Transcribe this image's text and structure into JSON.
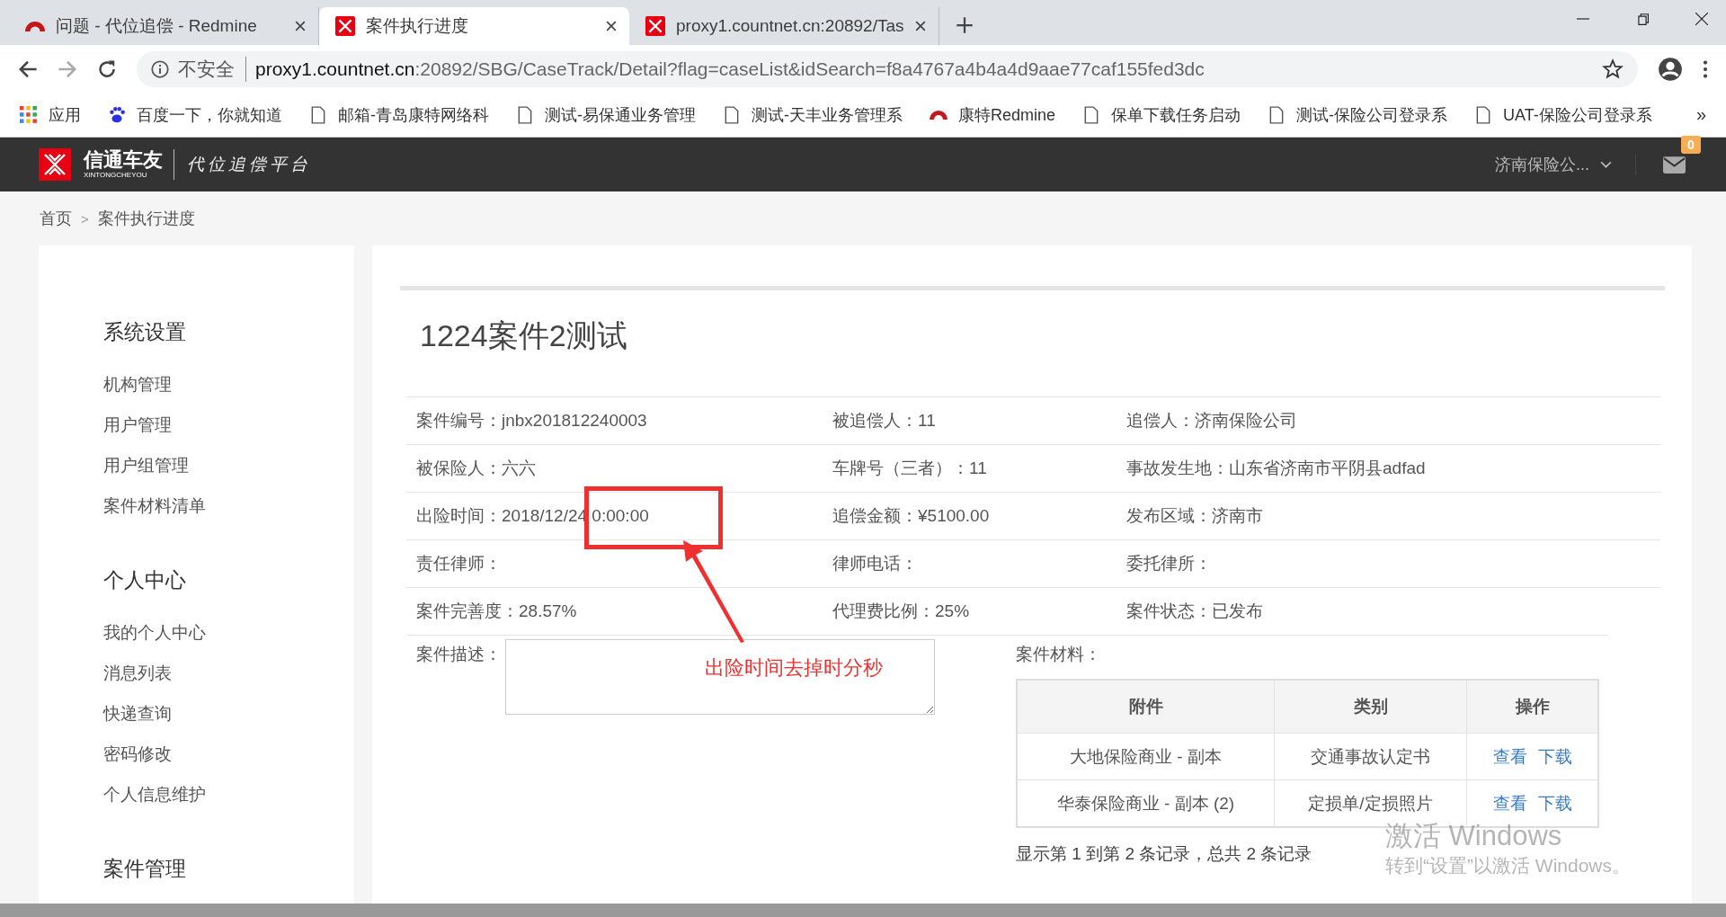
{
  "browser": {
    "tabs": [
      {
        "title": "问题 - 代位追偿 - Redmine",
        "kind": "redmine",
        "selected": false
      },
      {
        "title": "案件执行进度",
        "kind": "logo",
        "selected": true
      },
      {
        "title": "proxy1.countnet.cn:20892/Tas",
        "kind": "logo",
        "selected": false
      }
    ],
    "security": "不安全",
    "url_host": "proxy1.countnet.cn",
    "url_rest": ":20892/SBG/CaseTrack/Detail?flag=caseList&idSearch=f8a4767a4b4a4d9aae77caf155fed3dc",
    "bookmarks": [
      {
        "label": "应用",
        "kind": "apps"
      },
      {
        "label": "百度一下，你就知道",
        "kind": "paw"
      },
      {
        "label": "邮箱-青岛康特网络科",
        "kind": "page"
      },
      {
        "label": "测试-易保通业务管理",
        "kind": "page"
      },
      {
        "label": "测试-天丰业务管理系",
        "kind": "page"
      },
      {
        "label": "康特Redmine",
        "kind": "redmine"
      },
      {
        "label": "保单下载任务启动",
        "kind": "page"
      },
      {
        "label": "测试-保险公司登录系",
        "kind": "page"
      },
      {
        "label": "UAT-保险公司登录系",
        "kind": "page"
      }
    ],
    "more": "»"
  },
  "header": {
    "brand": "信通车友",
    "brand_sub": "XINTONGCHEYOU",
    "platform": "代位追偿平台",
    "account": "济南保险公...",
    "mail_count": "0"
  },
  "breadcrumb": [
    "首页",
    "案件执行进度"
  ],
  "breadcrumb_sep": ">",
  "sidebar": [
    {
      "title": "系统设置",
      "items": [
        "机构管理",
        "用户管理",
        "用户组管理",
        "案件材料清单"
      ]
    },
    {
      "title": "个人中心",
      "items": [
        "我的个人中心",
        "消息列表",
        "快递查询",
        "密码修改",
        "个人信息维护"
      ]
    },
    {
      "title": "案件管理"
    }
  ],
  "case": {
    "title": "1224案件2测试",
    "rows": [
      [
        {
          "label": "案件编号：",
          "value": "jnbx201812240003"
        },
        {
          "label": "被追偿人：",
          "value": "11"
        },
        {
          "label": "追偿人：",
          "value": "济南保险公司"
        }
      ],
      [
        {
          "label": "被保险人：",
          "value": "六六"
        },
        {
          "label": "车牌号（三者）：",
          "value": "11"
        },
        {
          "label": "事故发生地：",
          "value": "山东省济南市平阴县adfad"
        }
      ],
      [
        {
          "label": "出险时间：",
          "value": "2018/12/24 0:00:00"
        },
        {
          "label": "追偿金额：",
          "value": "¥5100.00"
        },
        {
          "label": "发布区域：",
          "value": "济南市"
        }
      ],
      [
        {
          "label": "责任律师："
        },
        {
          "label": "律师电话："
        },
        {
          "label": "委托律所："
        }
      ],
      [
        {
          "label": "案件完善度：",
          "value": "28.57%"
        },
        {
          "label": "代理费比例：",
          "value": "25%"
        },
        {
          "label": "案件状态：",
          "value": "已发布"
        }
      ]
    ],
    "description_label": "案件描述：",
    "materials_label": "案件材料：",
    "materials": {
      "columns": [
        "附件",
        "类别",
        "操作"
      ],
      "rows": [
        {
          "file": "大地保险商业 - 副本",
          "category": "交通事故认定书",
          "actions": [
            "查看",
            "下载"
          ]
        },
        {
          "file": "华泰保险商业 - 副本 (2)",
          "category": "定损单/定损照片",
          "actions": [
            "查看",
            "下载"
          ]
        }
      ],
      "summary": "显示第 1 到第 2 条记录，总共 2 条记录"
    }
  },
  "annotation": {
    "note": "出险时间去掉时分秒"
  },
  "os_notice": {
    "title": "激活 Windows",
    "text": "转到“设置”以激活 Windows。"
  }
}
